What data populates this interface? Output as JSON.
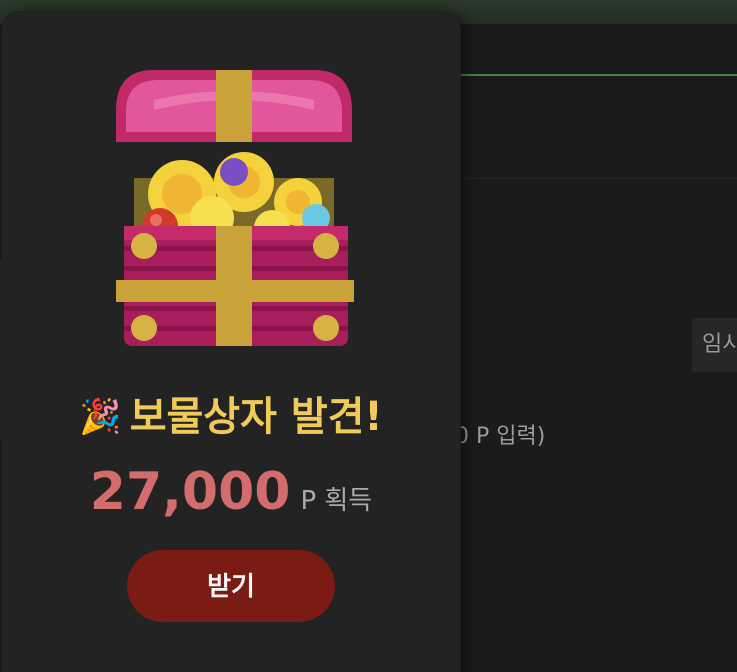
{
  "background": {
    "temp_button_label": "임시",
    "hint_text": "0 P 입력)"
  },
  "modal": {
    "icon": "treasure-chest-icon",
    "party_emoji": "🎉",
    "title": "보물상자 발견!",
    "reward_amount": "27,000",
    "reward_suffix": "P 획득",
    "claim_button_label": "받기"
  },
  "colors": {
    "title": "#f1cb5a",
    "amount": "#d36c6c",
    "claim_button": "#7a1c13",
    "accent_line": "#3c8a45"
  }
}
